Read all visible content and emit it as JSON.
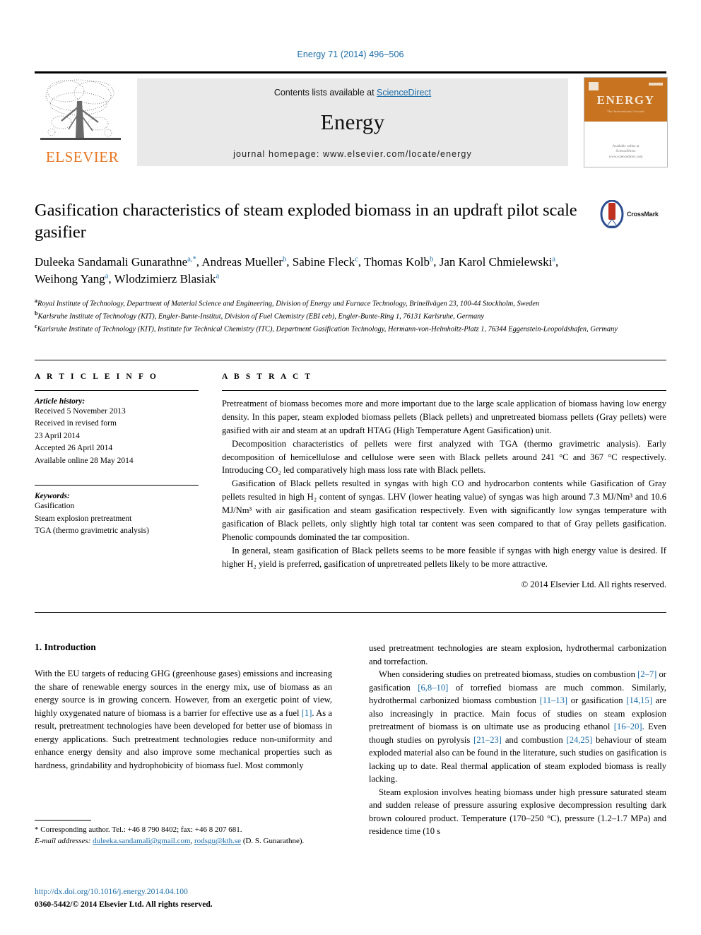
{
  "running_head": "Energy 71 (2014) 496–506",
  "journal_header": {
    "contents_prefix": "Contents lists available at ",
    "sciencedirect": "ScienceDirect",
    "journal_name": "Energy",
    "homepage": "journal homepage: www.elsevier.com/locate/energy",
    "publisher_logo_text": "ELSEVIER",
    "cover": {
      "title": "ENERGY",
      "subtitle": "The International Journal",
      "footer_line1": "Available online at",
      "footer_line2": "ScienceDirect",
      "footer_line3": "www.sciencedirect.com"
    },
    "accent_blue": "#1b6ca8",
    "elsevier_orange": "#E87722",
    "cover_orange": "#C8731F",
    "band_gray": "#e9e9e9"
  },
  "article": {
    "title": "Gasification characteristics of steam exploded biomass in an updraft pilot scale gasifier",
    "crossmark_label": "CrossMark",
    "authors": [
      {
        "name": "Duleeka Sandamali Gunarathne",
        "marks": "a,*"
      },
      {
        "name": "Andreas Mueller",
        "marks": "b"
      },
      {
        "name": "Sabine Fleck",
        "marks": "c"
      },
      {
        "name": "Thomas Kolb",
        "marks": "b"
      },
      {
        "name": "Jan Karol Chmielewski",
        "marks": "a"
      },
      {
        "name": "Weihong Yang",
        "marks": "a"
      },
      {
        "name": "Wlodzimierz Blasiak",
        "marks": "a"
      }
    ],
    "affiliations": [
      {
        "mark": "a",
        "text": "Royal Institute of Technology, Department of Material Science and Engineering, Division of Energy and Furnace Technology, Brinellvägen 23, 100-44 Stockholm, Sweden"
      },
      {
        "mark": "b",
        "text": "Karlsruhe Institute of Technology (KIT), Engler-Bunte-Institut, Division of Fuel Chemistry (EBI ceb), Engler-Bunte-Ring 1, 76131 Karlsruhe, Germany"
      },
      {
        "mark": "c",
        "text": "Karlsruhe Institute of Technology (KIT), Institute for Technical Chemistry (ITC), Department Gasification Technology, Hermann-von-Helmholtz-Platz 1, 76344 Eggenstein-Leopoldshafen, Germany"
      }
    ]
  },
  "article_info": {
    "heading": "A R T I C L E   I N F O",
    "history_label": "Article history:",
    "history": [
      "Received 5 November 2013",
      "Received in revised form",
      "23 April 2014",
      "Accepted 26 April 2014",
      "Available online 28 May 2014"
    ],
    "keywords_label": "Keywords:",
    "keywords": [
      "Gasification",
      "Steam explosion pretreatment",
      "TGA (thermo gravimetric analysis)"
    ]
  },
  "abstract": {
    "heading": "A B S T R A C T",
    "paragraphs": [
      "Pretreatment of biomass becomes more and more important due to the large scale application of biomass having low energy density. In this paper, steam exploded biomass pellets (Black pellets) and unpretreated biomass pellets (Gray pellets) were gasified with air and steam at an updraft HTAG (High Temperature Agent Gasification) unit.",
      "Decomposition characteristics of pellets were first analyzed with TGA (thermo gravimetric analysis). Early decomposition of hemicellulose and cellulose were seen with Black pellets around 241 °C and 367 °C respectively. Introducing CO₂ led comparatively high mass loss rate with Black pellets.",
      "Gasification of Black pellets resulted in syngas with high CO and hydrocarbon contents while Gasification of Gray pellets resulted in high H₂ content of syngas. LHV (lower heating value) of syngas was high around 7.3 MJ/Nm³ and 10.6 MJ/Nm³ with air gasification and steam gasification respectively. Even with significantly low syngas temperature with gasification of Black pellets, only slightly high total tar content was seen compared to that of Gray pellets gasification. Phenolic compounds dominated the tar composition.",
      "In general, steam gasification of Black pellets seems to be more feasible if syngas with high energy value is desired. If higher H₂ yield is preferred, gasification of unpretreated pellets likely to be more attractive."
    ],
    "copyright": "© 2014 Elsevier Ltd. All rights reserved."
  },
  "body": {
    "section_number_title": "1. Introduction",
    "left_paragraphs": [
      "With the EU targets of reducing GHG (greenhouse gases) emissions and increasing the share of renewable energy sources in the energy mix, use of biomass as an energy source is in growing concern. However, from an exergetic point of view, highly oxygenated nature of biomass is a barrier for effective use as a fuel [1]. As a result, pretreatment technologies have been developed for better use of biomass in energy applications. Such pretreatment technologies reduce non-uniformity and enhance energy density and also improve some mechanical properties such as hardness, grindability and hydrophobicity of biomass fuel. Most commonly"
    ],
    "right_paragraphs": [
      "used pretreatment technologies are steam explosion, hydrothermal carbonization and torrefaction.",
      "When considering studies on pretreated biomass, studies on combustion [2–7] or gasification [6,8–10] of torrefied biomass are much common. Similarly, hydrothermal carbonized biomass combustion [11–13] or gasification [14,15] are also increasingly in practice. Main focus of studies on steam explosion pretreatment of biomass is on ultimate use as producing ethanol [16–20]. Even though studies on pyrolysis [21–23] and combustion [24,25] behaviour of steam exploded material also can be found in the literature, such studies on gasification is lacking up to date. Real thermal application of steam exploded biomass is really lacking.",
      "Steam explosion involves heating biomass under high pressure saturated steam and sudden release of pressure assuring explosive decompression resulting dark brown coloured product. Temperature (170–250 °C), pressure (1.2–1.7 MPa) and residence time (10 s"
    ]
  },
  "footnotes": {
    "corresponding": "* Corresponding author. Tel.: +46 8 790 8402; fax: +46 8 207 681.",
    "email_label": "E-mail addresses:",
    "email1": "duleeka.sandamali@gmail.com",
    "email2": "rodsgu@kth.se",
    "email_suffix": "(D. S. Gunarathne).",
    "doi": "http://dx.doi.org/10.1016/j.energy.2014.04.100",
    "issn": "0360-5442/© 2014 Elsevier Ltd. All rights reserved."
  }
}
